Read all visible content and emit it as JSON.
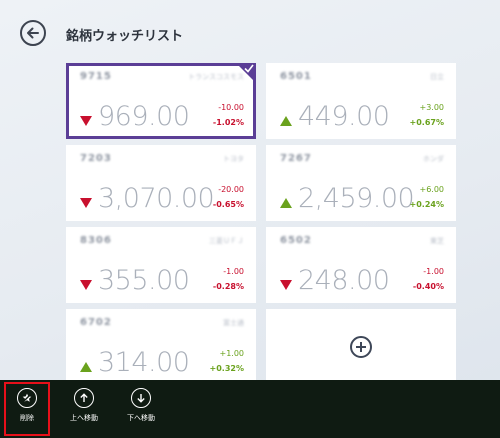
{
  "header": {
    "title": "銘柄ウォッチリスト",
    "back_icon": "back-arrow-icon"
  },
  "colors": {
    "selected": "#5b3e96",
    "down": "#c8102e",
    "up": "#6aa21d",
    "appbar": "#0f1b12",
    "highlight": "#e8101a"
  },
  "stocks": [
    {
      "code": "9715",
      "name": "トランスコスモス",
      "price": "969.00",
      "change": "-10.00",
      "percent": "-1.02%",
      "direction": "down",
      "selected": true
    },
    {
      "code": "6501",
      "name": "日立",
      "price": "449.00",
      "change": "+3.00",
      "percent": "+0.67%",
      "direction": "up",
      "selected": false
    },
    {
      "code": "7203",
      "name": "トヨタ",
      "price": "3,070.00",
      "change": "-20.00",
      "percent": "-0.65%",
      "direction": "down",
      "selected": false
    },
    {
      "code": "7267",
      "name": "ホンダ",
      "price": "2,459.00",
      "change": "+6.00",
      "percent": "+0.24%",
      "direction": "up",
      "selected": false
    },
    {
      "code": "8306",
      "name": "三菱ＵＦＪ",
      "price": "355.00",
      "change": "-1.00",
      "percent": "-0.28%",
      "direction": "down",
      "selected": false
    },
    {
      "code": "6502",
      "name": "東芝",
      "price": "248.00",
      "change": "-1.00",
      "percent": "-0.40%",
      "direction": "down",
      "selected": false
    },
    {
      "code": "6702",
      "name": "富士通",
      "price": "314.00",
      "change": "+1.00",
      "percent": "+0.32%",
      "direction": "up",
      "selected": false
    }
  ],
  "add_tile": {
    "icon": "plus-circle-icon"
  },
  "appbar": {
    "delete": {
      "label": "削除",
      "icon": "unpin-star-icon"
    },
    "move_up": {
      "label": "上へ移動",
      "icon": "arrow-up-icon"
    },
    "move_down": {
      "label": "下へ移動",
      "icon": "arrow-down-icon"
    }
  }
}
